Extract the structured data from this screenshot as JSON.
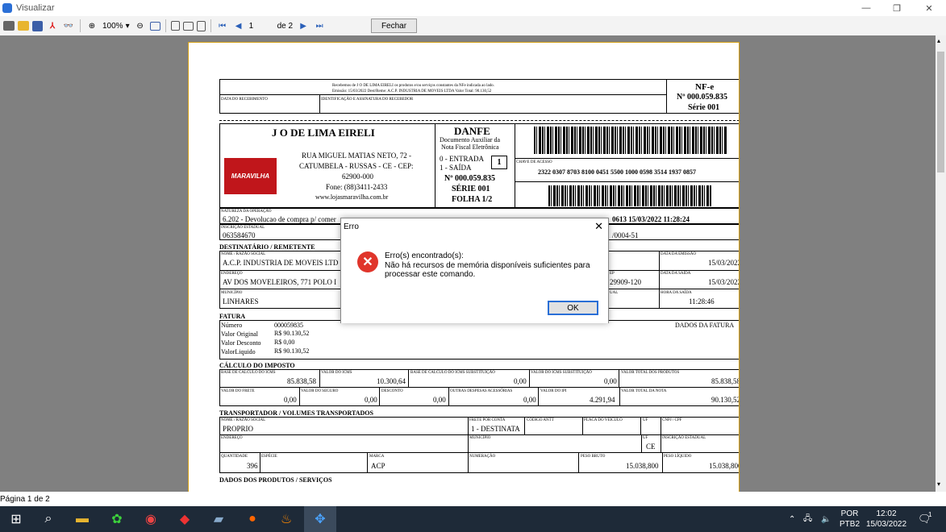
{
  "window": {
    "title": "Visualizar"
  },
  "toolbar": {
    "zoom": "100%",
    "page_input": "1",
    "page_of": "de 2",
    "fechar_label": "Fechar"
  },
  "danfe": {
    "receipt_line1": "Recebemos de J O DE LIMA EIRELI os produtos e/ou serviços constantes da NFe indicada ao lado.",
    "receipt_line2": "Emissão: 15/03/2022 Dest/Reme: A.C.P. INDUSTRIA DE MOVEIS LTDA Valor Total: 90.130,52",
    "lbl_data_recebimento": "DATA DO RECEBIMENTO",
    "lbl_ident": "IDENTIFICAÇÃO E ASSINATURA DO RECEBEDOR",
    "nfe_label": "NF-e",
    "nfe_number": "Nº 000.059.835",
    "nfe_serie": "Série 001",
    "company_name": "J O DE LIMA EIRELI",
    "logo_text": "MARAVILHA",
    "address1": "RUA MIGUEL MATIAS NETO, 72 -",
    "address2": "CATUMBELA - RUSSAS - CE - CEP:",
    "address3": "62900-000",
    "phone": "Fone: (88)3411-2433",
    "site": "www.lojasmaravilha.com.br",
    "danfe_title": "DANFE",
    "danfe_sub1": "Documento Auxiliar da",
    "danfe_sub2": "Nota Fiscal Eletrônica",
    "entrada": "0 - ENTRADA",
    "saida": "1 - SAÍDA",
    "tipo": "1",
    "danfe_num": "Nº 000.059.835",
    "danfe_serie": "SÉRIE 001",
    "folha": "FOLHA 1/2",
    "lbl_chave": "CHAVE DE ACESSO",
    "chave": "2322 0307 8703 8100 0451 5500 1000 0598 3514 1937 0857",
    "lbl_natureza": "NATUREZA DA OPERAÇÃO",
    "natureza": "6.202 - Devolucao de compra p/ comer",
    "protocolo": "0613 15/03/2022 11:28:24",
    "lbl_ie": "INSCRIÇÃO ESTADUAL",
    "ie": "063584670",
    "cnpj_partial": "/0004-51",
    "sec_dest": "DESTINATÁRIO / REMETENTE",
    "lbl_nome": "NOME / RAZÃO SOCIAL",
    "dest_nome": "A.C.P. INDUSTRIA DE MOVEIS LTD",
    "lbl_emissao": "DATA DA EMISSÃO",
    "emissao": "15/03/2022",
    "lbl_endereco": "ENDEREÇO",
    "dest_end": "AV DOS MOVELEIROS, 771  POLO I",
    "lbl_cep": "EP",
    "dest_cep": "29909-120",
    "lbl_saida": "DATA DA SAÍDA",
    "saida_data": "15/03/2022",
    "lbl_municipio": "MUNICÍPIO",
    "dest_mun": "LINHARES",
    "lbl_ual": "UAL",
    "lbl_hora": "HORA DA SAÍDA",
    "hora": "11:28:46",
    "sec_fatura": "FATURA",
    "fat_num_lbl": "Número",
    "fat_num": "000059835",
    "fat_orig_lbl": "Valor Original",
    "fat_orig": "R$ 90.130,52",
    "fat_desc_lbl": "Valor Desconto",
    "fat_desc": "R$ 0,00",
    "fat_liq_lbl": "ValorLiquido",
    "fat_liq": "R$ 90.130,52",
    "fat_dados": "DADOS DA FATURA",
    "sec_imposto": "CÁLCULO DO IMPOSTO",
    "imp": [
      {
        "lbl": "BASE DE CÁLCULO DO ICMS",
        "val": "85.838,58"
      },
      {
        "lbl": "VALOR DO ICMS",
        "val": "10.300,64"
      },
      {
        "lbl": "BASE DE CÁLCULO DO ICMS SUBSTITUIÇÃO",
        "val": "0,00"
      },
      {
        "lbl": "VALOR DO ICMS SUBSTITUIÇÃO",
        "val": "0,00"
      },
      {
        "lbl": "VALOR TOTAL DOS PRODUTOS",
        "val": "85.838,58"
      },
      {
        "lbl": "VALOR DO FRETE",
        "val": "0,00"
      },
      {
        "lbl": "VALOR DO SEGURO",
        "val": "0,00"
      },
      {
        "lbl": "DESCONTO",
        "val": "0,00"
      },
      {
        "lbl": "OUTRAS DESPESAS ACESSÓRIAS",
        "val": "0,00"
      },
      {
        "lbl": "VALOR DO IPI",
        "val": "4.291,94"
      },
      {
        "lbl": "VALOR TOTAL DA NOTA",
        "val": "90.130,52"
      }
    ],
    "sec_transp": "TRANSPORTADOR / VOLUMES TRANSPORTADOS",
    "tr_nome": "PROPRIO",
    "lbl_frete": "FRETE POR CONTA",
    "tr_frete": "1 - DESTINATA",
    "lbl_antt": "CÓDIGO ANTT",
    "lbl_placa": "PLACA DO VEÍCULO",
    "lbl_uf": "UF",
    "lbl_cnpj": "CNPJ / CPF",
    "lbl_ie2": "INSCRIÇÃO ESTADUAL",
    "tr_uf": "CE",
    "lbl_qtd": "QUANTIDADE",
    "tr_qtd": "396",
    "lbl_especie": "ESPÉCIE",
    "lbl_marca": "MARCA",
    "tr_marca": "ACP",
    "lbl_numeracao": "NUMERAÇÃO",
    "lbl_bruto": "PESO BRUTO",
    "tr_bruto": "15.038,800",
    "lbl_liquido": "PESO LÍQUIDO",
    "tr_liquido": "15.038,800",
    "sec_produtos": "DADOS DOS PRODUTOS / SERVIÇOS"
  },
  "dialog": {
    "title": "Erro",
    "close": "✕",
    "line1": "Erro(s) encontrado(s):",
    "line2": "Não há recursos de memória disponíveis suficientes para",
    "line3": "processar este comando.",
    "ok": "OK"
  },
  "status": {
    "page": "Página 1 de 2"
  },
  "tray": {
    "lang1": "POR",
    "lang2": "PTB2",
    "time": "12:02",
    "date": "15/03/2022",
    "notif_count": "1"
  }
}
